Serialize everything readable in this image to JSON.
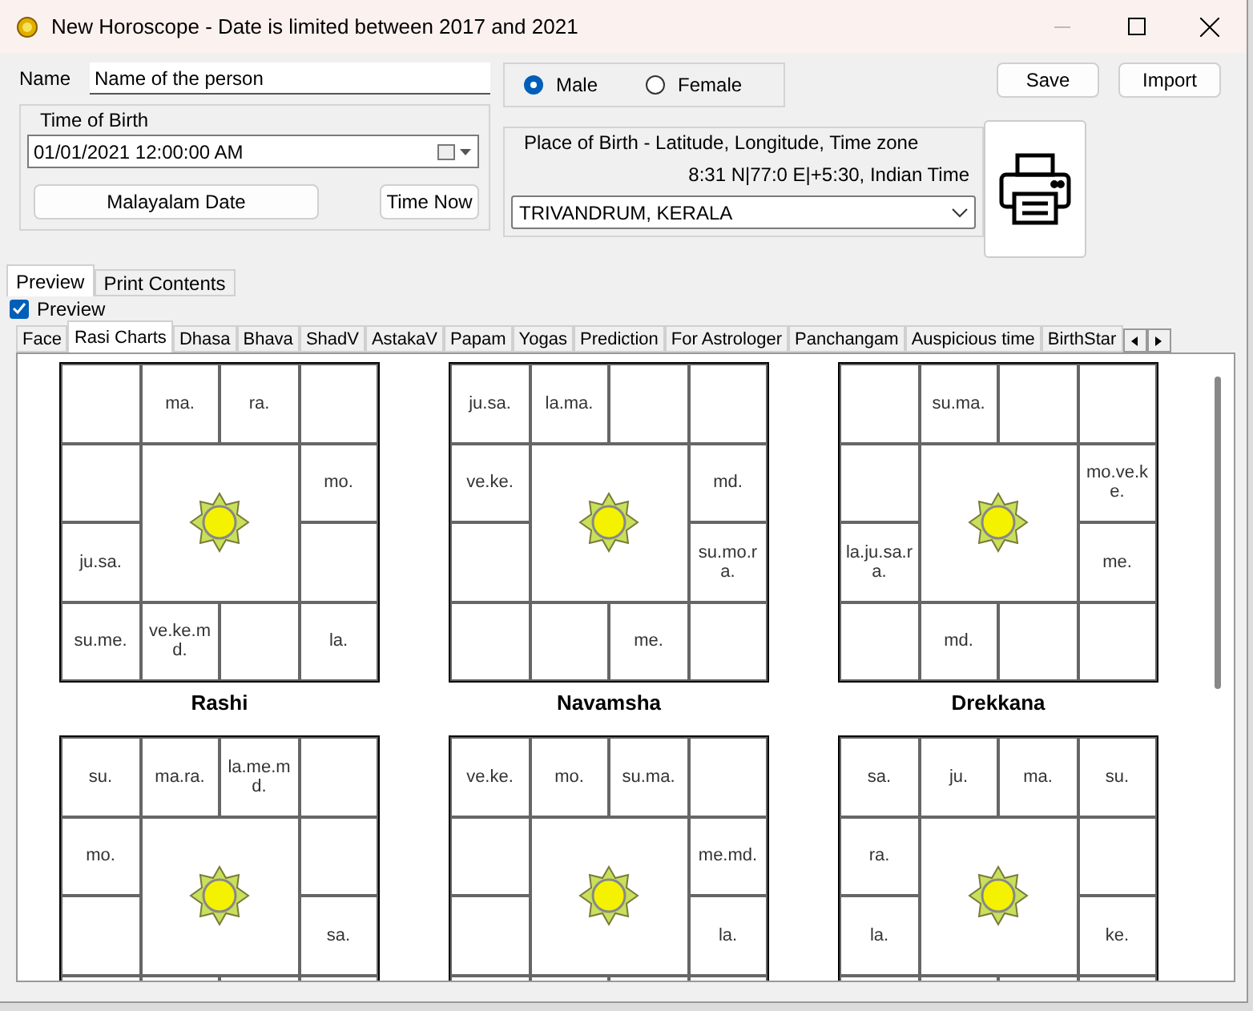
{
  "window": {
    "title": "New Horoscope - Date is limited between 2017 and 2021"
  },
  "name_field": {
    "label": "Name",
    "value": "Name of the person"
  },
  "gender": [
    {
      "label": "Male",
      "selected": true
    },
    {
      "label": "Female",
      "selected": false
    }
  ],
  "buttons": [
    "Save",
    "Import"
  ],
  "time_of_birth": {
    "title": "Time of Birth",
    "value": "01/01/2021  12:00:00 AM",
    "buttons": [
      "Malayalam Date",
      "Time Now"
    ]
  },
  "place_of_birth": {
    "title": "Place of Birth - Latitude, Longitude, Time zone",
    "coordinates": "8:31 N|77:0 E|+5:30, Indian Time",
    "value": "TRIVANDRUM, KERALA"
  },
  "view_tabs": [
    {
      "label": "Preview",
      "selected": true
    },
    {
      "label": "Print Contents",
      "selected": false
    }
  ],
  "preview_checkbox": {
    "label": "Preview",
    "checked": true
  },
  "chart_tabs": [
    {
      "label": "Face",
      "selected": false
    },
    {
      "label": "Rasi Charts",
      "selected": true
    },
    {
      "label": "Dhasa",
      "selected": false
    },
    {
      "label": "Bhava",
      "selected": false
    },
    {
      "label": "ShadV",
      "selected": false
    },
    {
      "label": "AstakaV",
      "selected": false
    },
    {
      "label": "Papam",
      "selected": false
    },
    {
      "label": "Yogas",
      "selected": false
    },
    {
      "label": "Prediction",
      "selected": false
    },
    {
      "label": "For Astrologer",
      "selected": false
    },
    {
      "label": "Panchangam",
      "selected": false
    },
    {
      "label": "Auspicious time",
      "selected": false
    },
    {
      "label": "BirthStar",
      "selected": false
    }
  ],
  "charts": [
    {
      "title": "Rashi",
      "cells": [
        null,
        "ma.",
        "ra.",
        null,
        null,
        "mo.",
        "ju.sa.",
        null,
        "su.me.",
        "ve.ke.md.",
        null,
        "la."
      ]
    },
    {
      "title": "Navamsha",
      "cells": [
        "ju.sa.",
        "la.ma.",
        null,
        null,
        "ve.ke.",
        "md.",
        null,
        "su.mo.ra.",
        null,
        null,
        "me.",
        null
      ]
    },
    {
      "title": "Drekkana",
      "cells": [
        null,
        "su.ma.",
        null,
        null,
        null,
        "mo.ve.ke.",
        "la.ju.sa.ra.",
        "me.",
        null,
        "md.",
        null,
        null
      ]
    },
    {
      "cells": [
        "su.",
        "ma.ra.",
        "la.me.md.",
        null,
        "mo.",
        null,
        null,
        "sa."
      ]
    },
    {
      "cells": [
        "ve.ke.",
        "mo.",
        "su.ma.",
        null,
        null,
        "me.md.",
        null,
        "la."
      ]
    },
    {
      "cells": [
        "sa.",
        "ju.",
        "ma.",
        "su.",
        "ra.",
        null,
        "la.",
        "ke."
      ]
    }
  ]
}
